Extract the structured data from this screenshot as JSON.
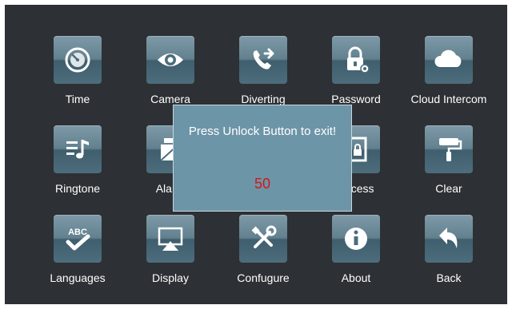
{
  "menu": {
    "items": [
      {
        "label": "Time",
        "icon": "clock-icon"
      },
      {
        "label": "Camera",
        "icon": "eye-icon"
      },
      {
        "label": "Diverting",
        "icon": "call-forward-icon"
      },
      {
        "label": "Password",
        "icon": "lock-gear-icon"
      },
      {
        "label": "Cloud Intercom",
        "icon": "cloud-icon"
      },
      {
        "label": "Ringtone",
        "icon": "music-list-icon"
      },
      {
        "label": "Alarm",
        "icon": "alarm-icon"
      },
      {
        "label": "Access",
        "icon": "door-lock-icon"
      },
      {
        "label": "Clear",
        "icon": "paint-roller-icon"
      },
      {
        "label": "Languages",
        "icon": "abc-check-icon"
      },
      {
        "label": "Display",
        "icon": "display-icon"
      },
      {
        "label": "Confugure",
        "icon": "tools-icon"
      },
      {
        "label": "About",
        "icon": "info-icon"
      },
      {
        "label": "Back",
        "icon": "back-arrow-icon"
      }
    ]
  },
  "dialog": {
    "message": "Press Unlock Button to exit!",
    "countdown": "50"
  },
  "colors": {
    "background": "#2d3034",
    "tile_top": "#7f9aa8",
    "tile_bottom": "#3f5e6e",
    "dialog": "#6d95a8",
    "countdown": "#d01818"
  }
}
